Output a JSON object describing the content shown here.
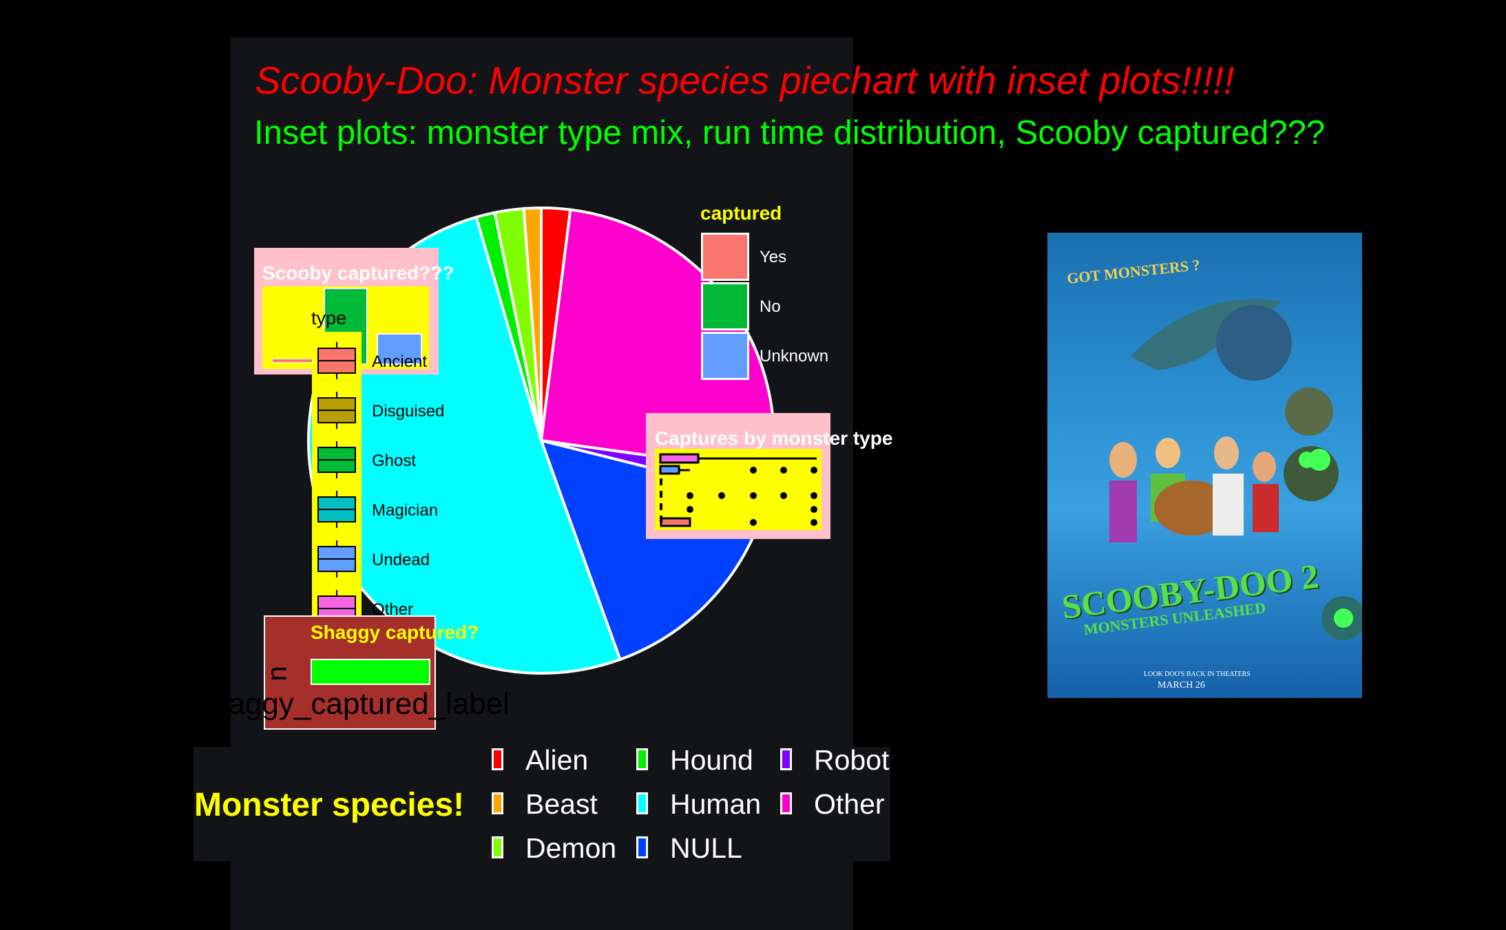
{
  "title": "Scooby-Doo: Monster species piechart with inset plots!!!!!",
  "subtitle": "Inset plots: monster type mix, run time distribution, Scooby captured???",
  "chart_data": [
    {
      "type": "pie",
      "legend_title": "Monster species!",
      "legend_position": "bottom",
      "categories": [
        "Alien",
        "Beast",
        "Demon",
        "Hound",
        "Human",
        "NULL",
        "Robot",
        "Other"
      ],
      "values": [
        2.0,
        1.2,
        2.0,
        1.3,
        51.0,
        15.6,
        1.7,
        25.2
      ],
      "colors": [
        "#ff0000",
        "#ffa500",
        "#7fff00",
        "#00ee00",
        "#00ffff",
        "#0040ff",
        "#8000ff",
        "#ff00cc"
      ],
      "legend_items": [
        {
          "label": "Alien",
          "color": "#ff0000"
        },
        {
          "label": "Beast",
          "color": "#ffa500"
        },
        {
          "label": "Demon",
          "color": "#7fff00"
        },
        {
          "label": "Hound",
          "color": "#00ee00"
        },
        {
          "label": "Human",
          "color": "#00ffff"
        },
        {
          "label": "NULL",
          "color": "#0040ff"
        },
        {
          "label": "Robot",
          "color": "#8000ff"
        },
        {
          "label": "Other",
          "color": "#ff00cc"
        }
      ]
    },
    {
      "type": "bar",
      "title": "Scooby captured???",
      "legend_title": "captured",
      "categories": [
        "Yes",
        "No",
        "Unknown"
      ],
      "values": [
        0.02,
        0.9,
        0.4
      ],
      "colors": [
        "#f8766d",
        "#00ba38",
        "#619cff"
      ]
    },
    {
      "type": "box",
      "title": "Captures by monster type",
      "legend_title": "type",
      "categories": [
        "Ancient",
        "Disguised",
        "Ghost",
        "Magician",
        "Undead",
        "Other"
      ],
      "colors": [
        "#f8766d",
        "#b79f00",
        "#00ba38",
        "#00bfc4",
        "#619cff",
        "#f564e3"
      ]
    },
    {
      "type": "bar",
      "title": "Shaggy captured?",
      "ylabel": "n",
      "xlabel": "shaggy_captured_label",
      "values": [
        1
      ],
      "colors": [
        "#00ff00"
      ]
    }
  ],
  "poster": {
    "tagline": "GOT MONSTERS ?",
    "title": "SCOOBY-DOO 2",
    "subtitle": "MONSTERS UNLEASHED",
    "date_line": "LOOK DOO'S BACK IN THEATERS",
    "date": "MARCH 26"
  }
}
